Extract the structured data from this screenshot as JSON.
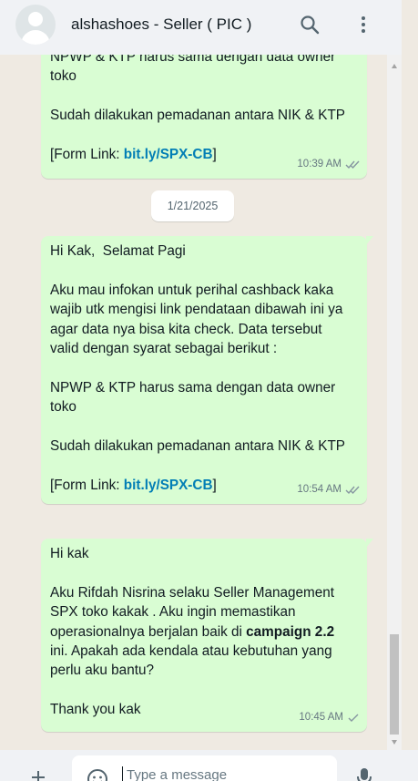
{
  "header": {
    "title": "alshashoes - Seller ( PIC )"
  },
  "messages": [
    {
      "text_before": "NPWP & KTP harus sama dengan data owner\ntoko\n\nSudah dilakukan pemadanan antara NIK & KTP\n\n[Form Link: ",
      "link": "bit.ly/SPX-CB",
      "text_after": "]",
      "time": "10:39 AM",
      "status": "delivered-double-check"
    },
    {
      "text_before": "Hi Kak,  Selamat Pagi\n\nAku mau infokan untuk perihal cashback kaka\nwajib utk mengisi link pendataan dibawah ini ya\nagar data nya bisa kita check. Data tersebut\nvalid dengan syarat sebagai berikut :\n\nNPWP & KTP harus sama dengan data owner\ntoko\n\nSudah dilakukan pemadanan antara NIK & KTP\n\n[Form Link: ",
      "link": "bit.ly/SPX-CB",
      "text_after": "]",
      "time": "10:54 AM",
      "status": "delivered-double-check"
    },
    {
      "text_before": "Hi kak\n\nAku Rifdah Nisrina selaku Seller Management\nSPX toko kakak . Aku ingin memastikan\noperasionalnya berjalan baik di ",
      "bold": "campaign 2.2",
      "text_after": "\nini. Apakah ada kendala atau kebutuhan yang\nperlu aku bantu?\n\nThank you kak",
      "time": "10:45 AM",
      "status": "sent-single-check"
    }
  ],
  "date_separator": "1/21/2025",
  "composer": {
    "placeholder": "Type a message"
  },
  "icons": {
    "search": "search-icon",
    "menu": "more-vertical-icon",
    "attach": "plus-icon",
    "emoji": "emoji-icon",
    "mic": "microphone-icon"
  },
  "colors": {
    "bubble": "#d9fdd3",
    "link": "#027eb5",
    "header": "#f0f2f5",
    "chat_bg": "#efeae2"
  }
}
